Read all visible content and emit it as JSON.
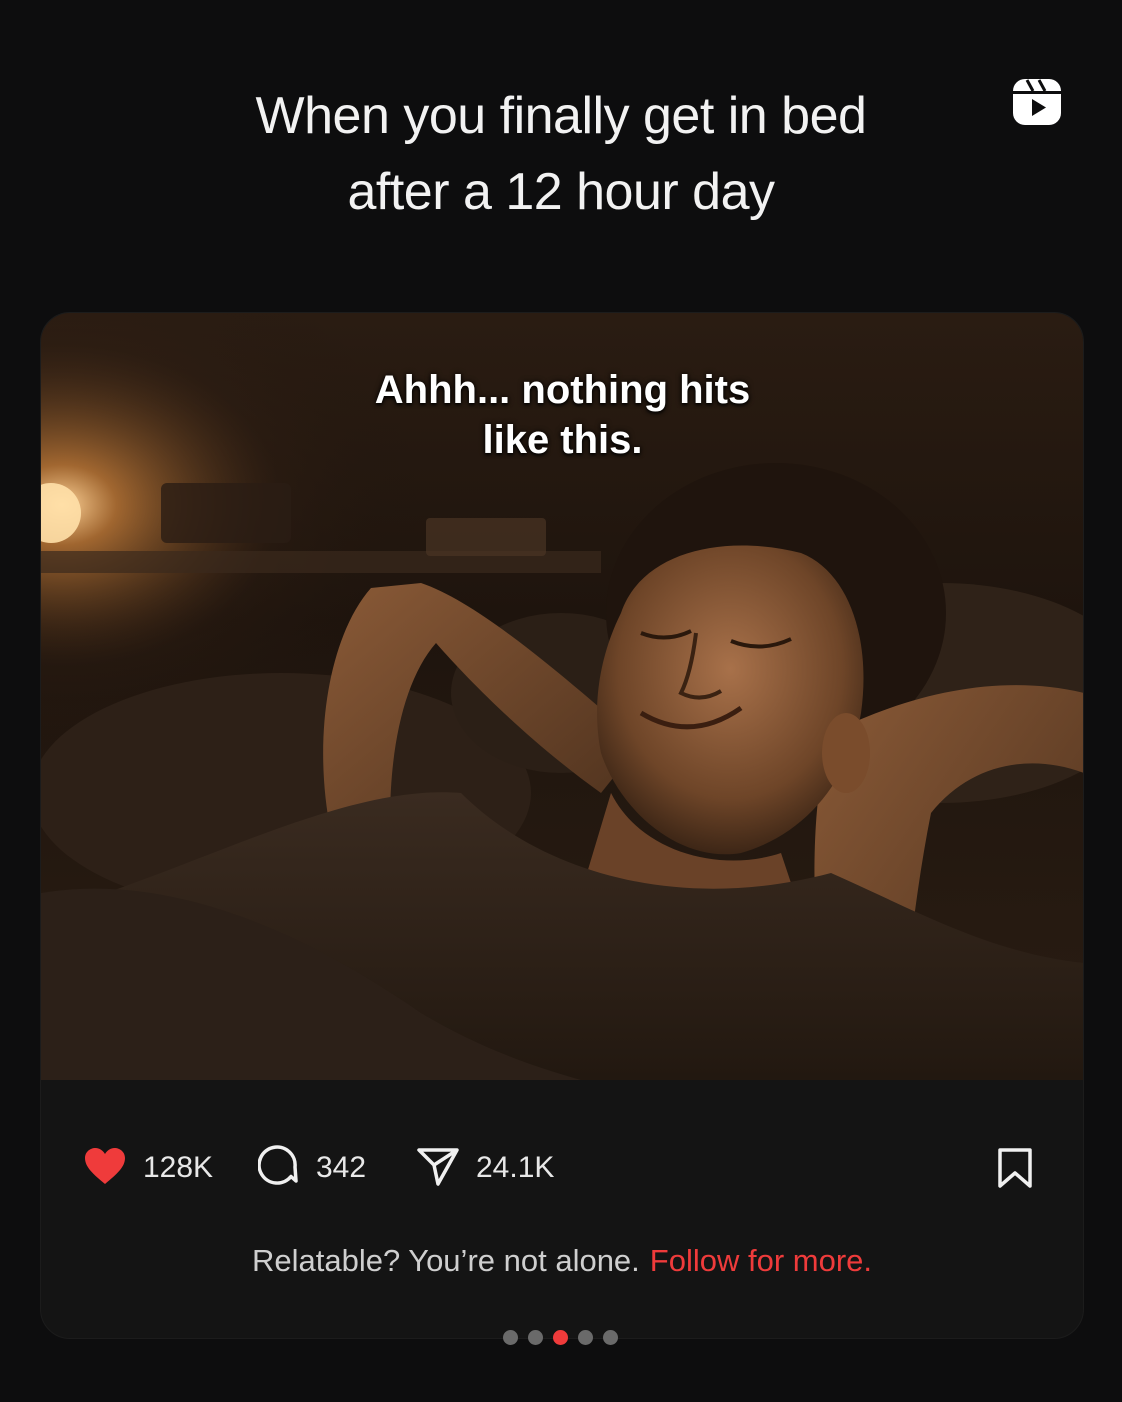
{
  "headline": {
    "line1": "When you finally get in bed",
    "line2": "after a 12 hour day"
  },
  "header": {
    "reels_icon": "reels-icon"
  },
  "post": {
    "image_caption": {
      "line1": "Ahhh... nothing hits",
      "line2": "like this."
    },
    "image_alt": "man relaxing in bed with hands behind head",
    "actions": {
      "likes": "128K",
      "comments": "342",
      "shares": "24.1K"
    },
    "icons": [
      "heart-icon",
      "comment-icon",
      "share-icon",
      "bookmark-icon"
    ],
    "footer": {
      "text": "Relatable? You’re not alone.",
      "cta": "Follow for more."
    }
  },
  "pagination": {
    "count": 5,
    "active_index": 2
  },
  "colors": {
    "background": "#0d0d0e",
    "card": "#141414",
    "accent": "#ef3b3b",
    "text": "#f2f2f2"
  }
}
